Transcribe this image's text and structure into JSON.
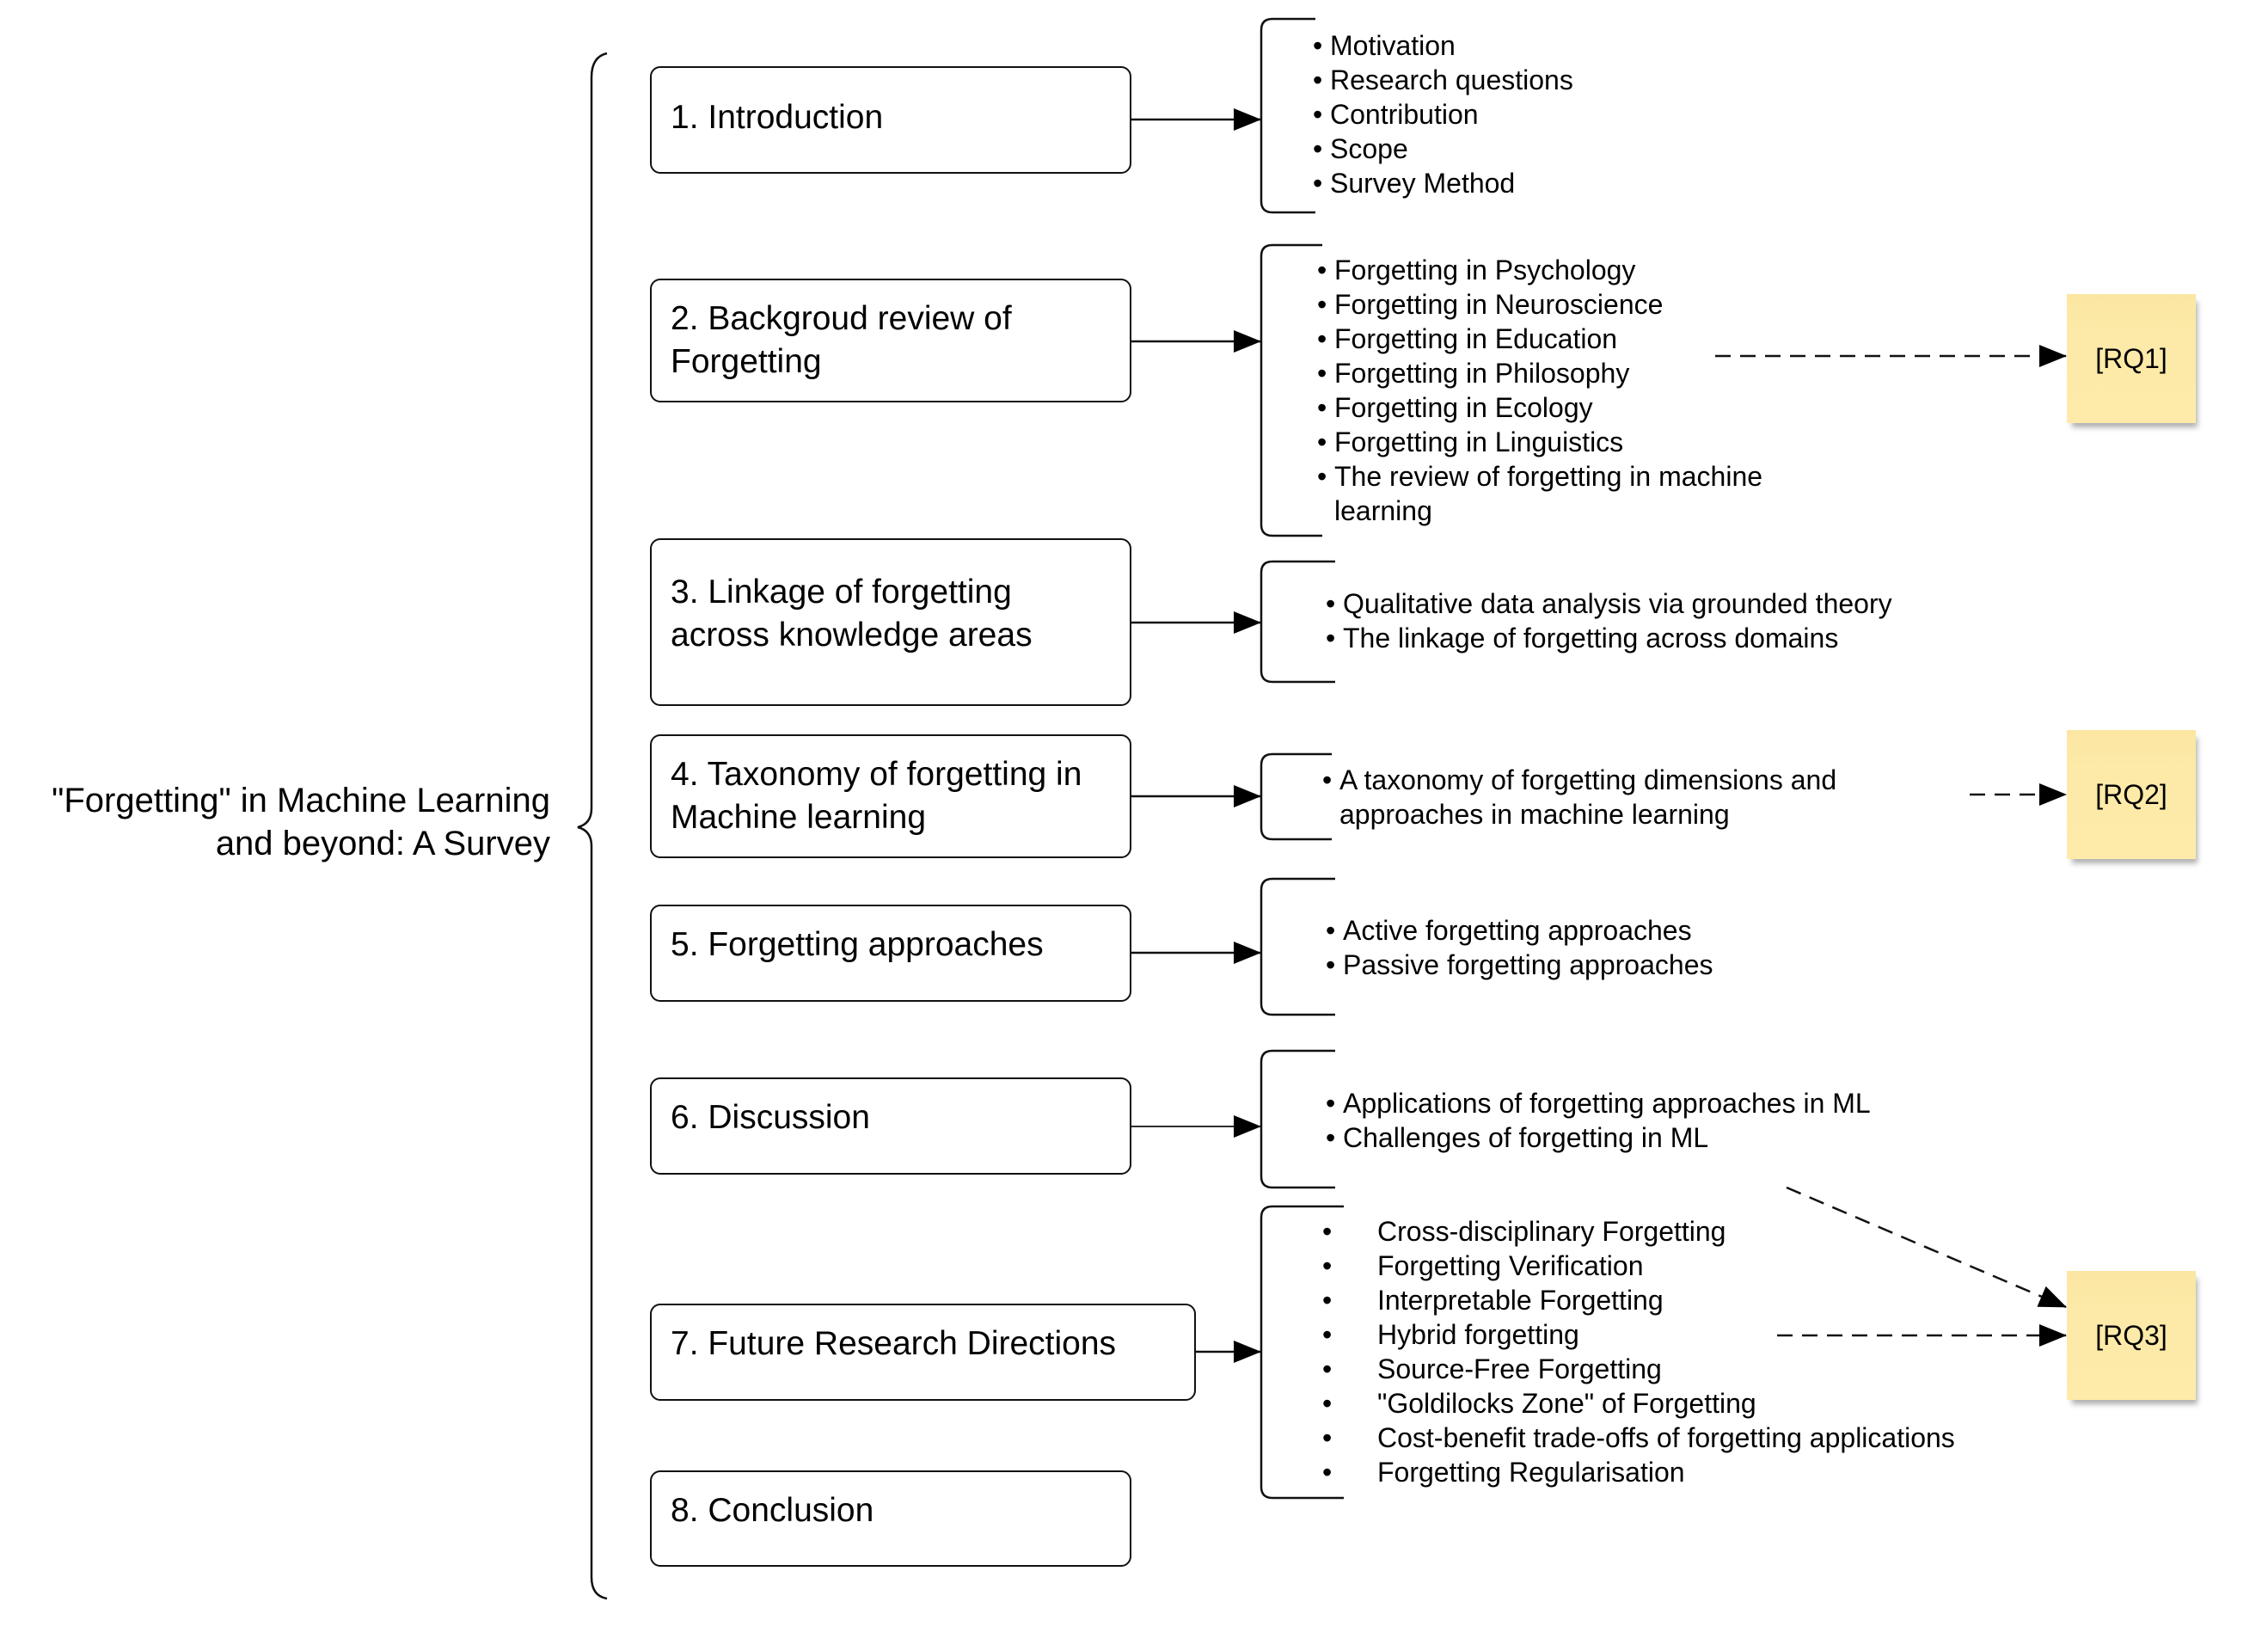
{
  "title": {
    "line1": "\"Forgetting\" in Machine Learning",
    "line2": "and beyond: A Survey"
  },
  "sections": [
    {
      "number": "1.",
      "label": "Introduction",
      "lines": [
        "1. Introduction"
      ],
      "items": [
        "Motivation",
        "Research questions",
        "Contribution",
        "Scope",
        "Survey Method"
      ]
    },
    {
      "number": "2.",
      "label": "Backgroud review of Forgetting",
      "lines": [
        "2. Backgroud review of",
        "Forgetting"
      ],
      "items": [
        "Forgetting in Psychology",
        "Forgetting in Neuroscience",
        "Forgetting in Education",
        "Forgetting in Philosophy",
        "Forgetting in Ecology",
        "Forgetting in Linguistics",
        "The review of forgetting in machine learning"
      ]
    },
    {
      "number": "3.",
      "label": "Linkage of forgetting across knowledge areas",
      "lines": [
        "3. Linkage of forgetting",
        "across knowledge areas"
      ],
      "items": [
        "Qualitative data analysis via grounded theory",
        "The linkage of forgetting across domains"
      ]
    },
    {
      "number": "4.",
      "label": "Taxonomy of forgetting in Machine learning",
      "lines": [
        "4. Taxonomy of forgetting in",
        "Machine learning"
      ],
      "items": [
        "A taxonomy of forgetting dimensions and approaches in machine learning"
      ]
    },
    {
      "number": "5.",
      "label": "Forgetting approaches",
      "lines": [
        "5. Forgetting approaches"
      ],
      "items": [
        "Active forgetting approaches",
        "Passive forgetting approaches"
      ]
    },
    {
      "number": "6.",
      "label": "Discussion",
      "lines": [
        "6. Discussion"
      ],
      "items": [
        "Applications of forgetting approaches in ML",
        "Challenges of forgetting in ML"
      ]
    },
    {
      "number": "7.",
      "label": "Future Research Directions",
      "lines": [
        "7. Future Research Directions"
      ],
      "items": [
        "Cross-disciplinary Forgetting",
        "Forgetting Verification",
        "Interpretable Forgetting",
        "Hybrid forgetting",
        "Source-Free Forgetting",
        "\"Goldilocks Zone\" of Forgetting",
        "Cost-benefit trade-offs of forgetting applications",
        "Forgetting Regularisation"
      ]
    },
    {
      "number": "8.",
      "label": "Conclusion",
      "lines": [
        "8. Conclusion"
      ],
      "items": []
    }
  ],
  "item_wrap": {
    "s2_last": [
      "The review of forgetting in machine",
      "learning"
    ],
    "s4_first": [
      "A taxonomy of forgetting dimensions and",
      "approaches in machine learning"
    ]
  },
  "bullet_icon": "•",
  "research_questions": [
    {
      "label": "[RQ1]",
      "linked_sections": [
        2
      ]
    },
    {
      "label": "[RQ2]",
      "linked_sections": [
        4
      ]
    },
    {
      "label": "[RQ3]",
      "linked_sections": [
        6,
        7
      ]
    }
  ],
  "colors": {
    "sticky": "#fde9a6",
    "line": "#111111",
    "background": "#ffffff"
  }
}
